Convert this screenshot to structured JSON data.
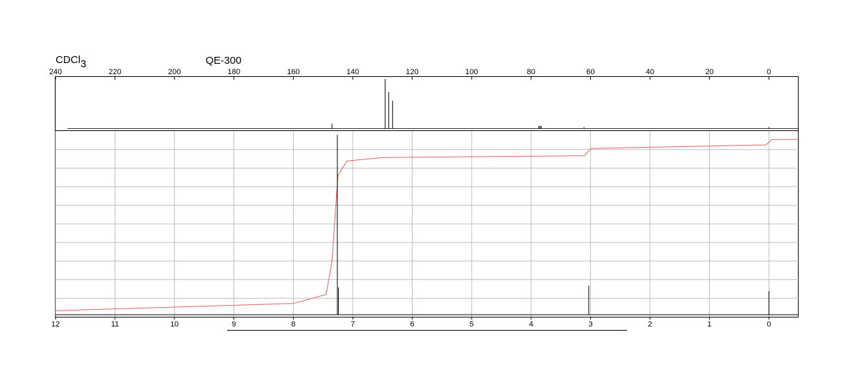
{
  "header": {
    "solvent": "CDCl",
    "solvent_subscript": "3",
    "instrument": "QE-300"
  },
  "chart_data": [
    {
      "type": "line",
      "name": "13C",
      "xlim": [
        240,
        -10
      ],
      "x_reversed": true,
      "ticks": [
        240,
        220,
        200,
        180,
        160,
        140,
        120,
        100,
        80,
        60,
        40,
        20,
        0
      ],
      "tick_labels": [
        "240",
        "220",
        "200",
        "180",
        "160",
        "140",
        "120",
        "100",
        "80",
        "60",
        "40",
        "20",
        "0"
      ],
      "grid": false,
      "peaks": [
        {
          "x": 147.0,
          "h": 0.1
        },
        {
          "x": 129.1,
          "h": 0.98
        },
        {
          "x": 127.9,
          "h": 0.72
        },
        {
          "x": 126.6,
          "h": 0.55
        },
        {
          "x": 77.4,
          "h": 0.05
        },
        {
          "x": 77.0,
          "h": 0.06
        },
        {
          "x": 76.6,
          "h": 0.05
        },
        {
          "x": 62.2,
          "h": 0.03
        },
        {
          "x": 0.0,
          "h": 0.03
        }
      ]
    },
    {
      "type": "line",
      "name": "1H",
      "xlim": [
        12,
        -0.5
      ],
      "x_reversed": true,
      "ticks": [
        12,
        11,
        10,
        9,
        8,
        7,
        6,
        5,
        4,
        3,
        2,
        1,
        0
      ],
      "tick_labels": [
        "12",
        "11",
        "10",
        "9",
        "8",
        "7",
        "6",
        "5",
        "4",
        "3",
        "2",
        "1",
        "0"
      ],
      "grid": true,
      "peaks": [
        {
          "x": 7.26,
          "h": 0.99
        },
        {
          "x": 7.24,
          "h": 0.15
        },
        {
          "x": 3.03,
          "h": 0.16
        },
        {
          "x": 0.0,
          "h": 0.13
        }
      ],
      "integral": [
        {
          "x": 12.0,
          "y": 0.03
        },
        {
          "x": 10.0,
          "y": 0.05
        },
        {
          "x": 8.0,
          "y": 0.07
        },
        {
          "x": 7.45,
          "y": 0.12
        },
        {
          "x": 7.35,
          "y": 0.3
        },
        {
          "x": 7.25,
          "y": 0.78
        },
        {
          "x": 7.1,
          "y": 0.86
        },
        {
          "x": 6.5,
          "y": 0.88
        },
        {
          "x": 3.1,
          "y": 0.89
        },
        {
          "x": 3.0,
          "y": 0.93
        },
        {
          "x": 0.05,
          "y": 0.95
        },
        {
          "x": -0.05,
          "y": 0.98
        },
        {
          "x": -0.5,
          "y": 0.98
        }
      ]
    }
  ]
}
